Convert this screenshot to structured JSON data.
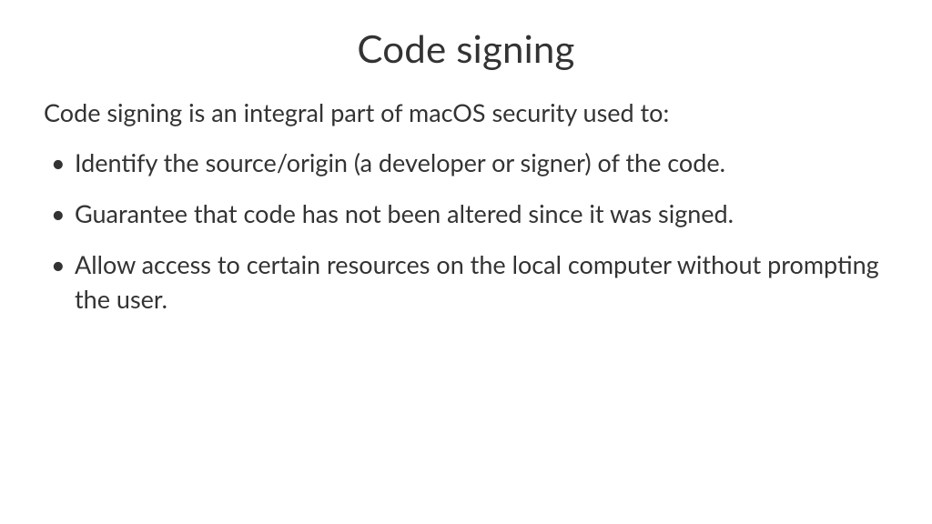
{
  "title": "Code signing",
  "intro": "Code signing is an integral part of macOS security used to:",
  "bullets": [
    {
      "text": "Identify the source/origin (a developer or signer) of the code."
    },
    {
      "text": "Guarantee that code has not been altered since it was signed."
    },
    {
      "text": "Allow access to certain resources on the local computer without prompting the user."
    }
  ]
}
